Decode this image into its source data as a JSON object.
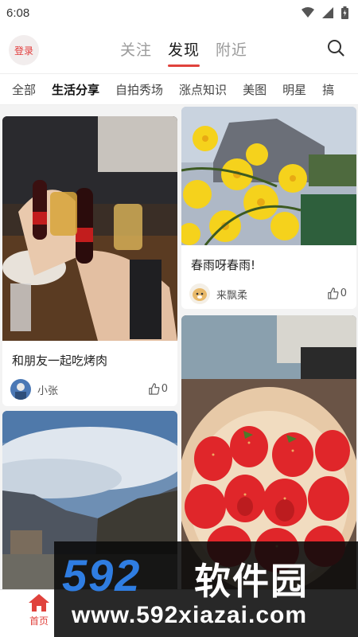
{
  "status_bar": {
    "time": "6:08",
    "icons": [
      "wifi-icon",
      "signal-icon",
      "battery-icon"
    ]
  },
  "header": {
    "login_label": "登录",
    "tabs": [
      {
        "label": "关注",
        "active": false
      },
      {
        "label": "发现",
        "active": true
      },
      {
        "label": "附近",
        "active": false
      }
    ],
    "search_icon": "search-icon"
  },
  "categories": [
    "全部",
    "生活分享",
    "自拍秀场",
    "涨点知识",
    "美图",
    "明星",
    "搞"
  ],
  "active_category": "生活分享",
  "feed": {
    "cards": [
      {
        "title": "和朋友一起吃烤肉",
        "author": "小张",
        "likes": "0",
        "image": "bbq-drinks-photo"
      },
      {
        "title": "春雨呀春雨!",
        "author": "来飘柔",
        "likes": "0",
        "image": "yellow-flowers-photo"
      },
      {
        "title": "",
        "author": "",
        "likes": "",
        "image": "mountain-sky-photo"
      },
      {
        "title": "",
        "author": "",
        "likes": "",
        "image": "strawberries-photo"
      }
    ]
  },
  "bottom_nav": {
    "home_label": "首页",
    "home_icon": "home-icon"
  },
  "watermark": {
    "logo": "592",
    "brand": "软件园",
    "url": "www.592xiazai.com"
  },
  "colors": {
    "accent": "#e0423c",
    "watermark_blue": "#2f7de1"
  }
}
